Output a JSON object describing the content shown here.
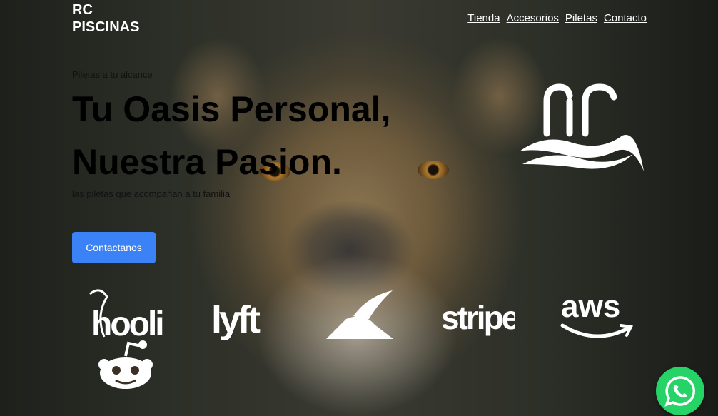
{
  "nav": {
    "brand": "RC\nPISCINAS",
    "links": [
      {
        "label": "Tienda"
      },
      {
        "label": "Accesorios"
      },
      {
        "label": "Piletas"
      },
      {
        "label": "Contacto"
      }
    ]
  },
  "hero": {
    "tagline": "Piletas a tu alcance",
    "headline": "Tu Oasis Personal,\nNuestra Pasion.",
    "subtitle": "las piletas que acompañan a tu familia",
    "cta_label": "Contactanos",
    "cta_color": "#3b82f6"
  },
  "partners": [
    {
      "name": "hooli",
      "icon": "hooli-logo-icon"
    },
    {
      "name": "lyft",
      "icon": "lyft-logo-icon"
    },
    {
      "name": "pied-piper",
      "icon": "pied-piper-logo-icon"
    },
    {
      "name": "stripe",
      "icon": "stripe-logo-icon"
    },
    {
      "name": "aws",
      "icon": "aws-logo-icon"
    },
    {
      "name": "reddit",
      "icon": "reddit-logo-icon"
    }
  ],
  "whatsapp": {
    "icon": "whatsapp-icon",
    "color": "#25d366"
  }
}
